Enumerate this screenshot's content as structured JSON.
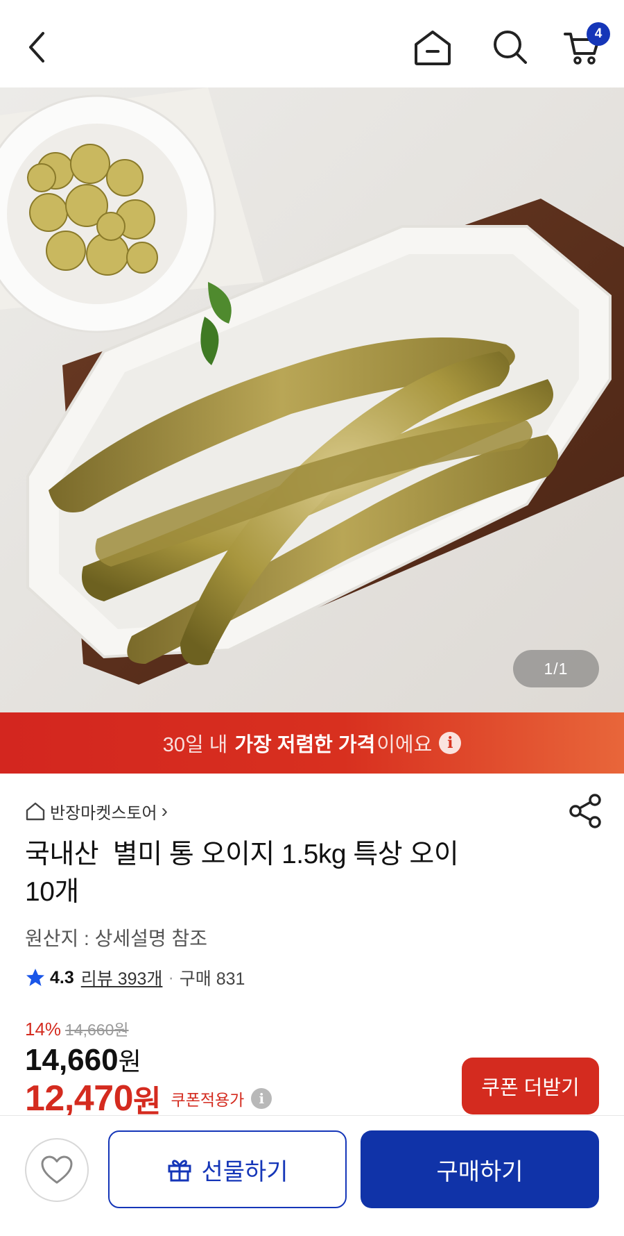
{
  "header": {
    "back_icon": "chevron-left-icon",
    "home_icon": "home-icon",
    "search_icon": "search-icon",
    "cart_icon": "cart-icon",
    "cart_count": "4"
  },
  "gallery": {
    "image_alt": "통 오이지 상품 사진",
    "pager": "1/1"
  },
  "promo": {
    "prefix": "30일 내",
    "highlight": "가장 저렴한 가격",
    "suffix": "이에요",
    "info_icon": "i"
  },
  "product": {
    "store_name": "반장마켓스토어",
    "store_chevron": "›",
    "title_line1": "국내산  별미 통 오이지 1.5kg 특상 오이",
    "title_line2": "10개",
    "origin": "원산지 : 상세설명 참조",
    "rating": "4.3",
    "reviews": "리뷰 393개",
    "separator": "·",
    "purchases": "구매 831"
  },
  "pricing": {
    "discount_pct": "14%",
    "original_price": "14,660원",
    "price_amount": "14,660",
    "price_unit": "원",
    "coupon_amount": "12,470",
    "coupon_unit": "원",
    "coupon_label": "쿠폰적용가",
    "coupon_info": "i",
    "coupon_button": "쿠폰 더받기"
  },
  "bottom_bar": {
    "wishlist_icon": "heart-icon",
    "gift_label": "선물하기",
    "buy_label": "구매하기"
  },
  "colors": {
    "brand_blue": "#1033a8",
    "accent_red": "#d42b1f"
  }
}
